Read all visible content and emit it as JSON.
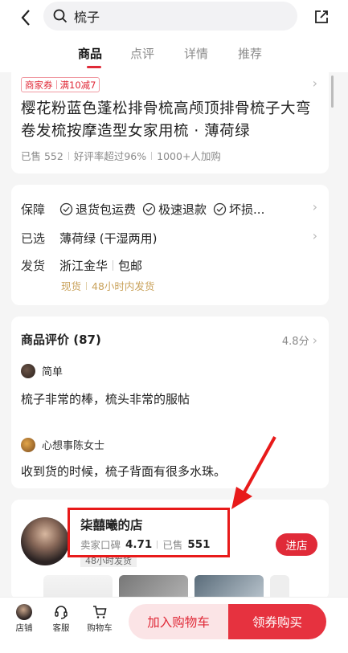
{
  "search": {
    "query": "梳子"
  },
  "tabs": [
    {
      "label": "商品"
    },
    {
      "label": "点评"
    },
    {
      "label": "详情"
    },
    {
      "label": "推荐"
    }
  ],
  "product": {
    "coupon_label": "商家券",
    "coupon_value": "满10减7",
    "title": "樱花粉蓝色蓬松排骨梳高颅顶排骨梳子大弯卷发梳按摩造型女家用梳 · 薄荷绿",
    "stats": [
      "已售 552",
      "好评率超过96%",
      "1000+人加购"
    ]
  },
  "info": {
    "guarantee_label": "保障",
    "guarantees": [
      "退货包运费",
      "极速退款",
      "坏损..."
    ],
    "selected_label": "已选",
    "selected_value": "薄荷绿 (干湿两用)",
    "shipping_label": "发货",
    "shipping_from": "浙江金华",
    "shipping_fee": "包邮",
    "stock": "现货",
    "dispatch": "48小时内发货"
  },
  "reviews": {
    "title": "商品评价 (87)",
    "score": "4.8分",
    "items": [
      {
        "user": "简单",
        "text": "梳子非常的棒，梳头非常的服帖"
      },
      {
        "user": "心想事陈女士",
        "text": "收到货的时候，梳子背面有很多水珠。"
      }
    ]
  },
  "store": {
    "name": "柒囍曦的店",
    "rating_label": "卖家口碑",
    "rating_value": "4.71",
    "sold_label": "已售",
    "sold_value": "551",
    "tag": "48小时发货",
    "enter_label": "进店"
  },
  "bottom": {
    "store_label": "店铺",
    "service_label": "客服",
    "cart_label": "购物车",
    "add_cart_label": "加入购物车",
    "buy_label": "领券购买"
  },
  "colors": {
    "accent": "#e02a38",
    "annotation": "#e81a1a"
  }
}
